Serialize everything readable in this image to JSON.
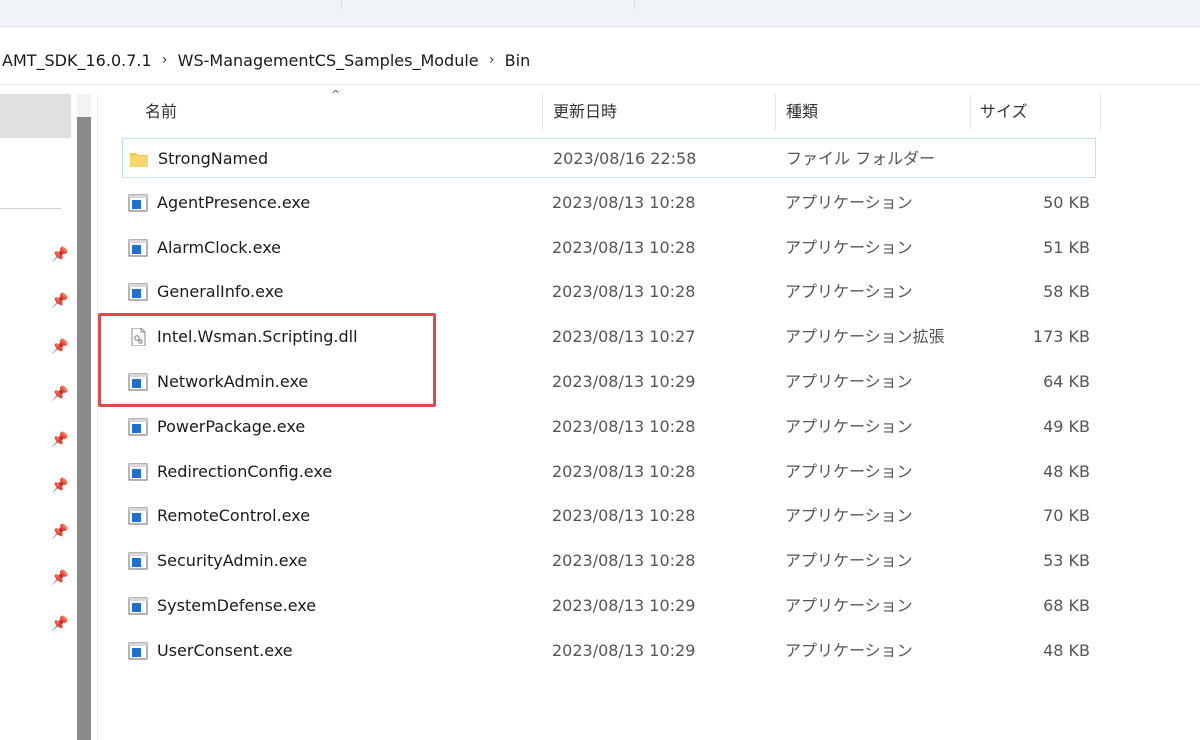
{
  "breadcrumb": {
    "items": [
      "AMT_SDK_16.0.7.1",
      "WS-ManagementCS_Samples_Module",
      "Bin"
    ]
  },
  "columns": {
    "name": "名前",
    "date": "更新日時",
    "type": "種類",
    "size": "サイズ"
  },
  "files": [
    {
      "name": "StrongNamed",
      "date": "2023/08/16 22:58",
      "type": "ファイル フォルダー",
      "size": "",
      "icon": "folder-icon"
    },
    {
      "name": "AgentPresence.exe",
      "date": "2023/08/13 10:28",
      "type": "アプリケーション",
      "size": "50 KB",
      "icon": "application-icon"
    },
    {
      "name": "AlarmClock.exe",
      "date": "2023/08/13 10:28",
      "type": "アプリケーション",
      "size": "51 KB",
      "icon": "application-icon"
    },
    {
      "name": "GeneralInfo.exe",
      "date": "2023/08/13 10:28",
      "type": "アプリケーション",
      "size": "58 KB",
      "icon": "application-icon"
    },
    {
      "name": "Intel.Wsman.Scripting.dll",
      "date": "2023/08/13 10:27",
      "type": "アプリケーション拡張",
      "size": "173 KB",
      "icon": "dll-file-icon"
    },
    {
      "name": "NetworkAdmin.exe",
      "date": "2023/08/13 10:29",
      "type": "アプリケーション",
      "size": "64 KB",
      "icon": "application-icon"
    },
    {
      "name": "PowerPackage.exe",
      "date": "2023/08/13 10:28",
      "type": "アプリケーション",
      "size": "49 KB",
      "icon": "application-icon"
    },
    {
      "name": "RedirectionConfig.exe",
      "date": "2023/08/13 10:28",
      "type": "アプリケーション",
      "size": "48 KB",
      "icon": "application-icon"
    },
    {
      "name": "RemoteControl.exe",
      "date": "2023/08/13 10:28",
      "type": "アプリケーション",
      "size": "70 KB",
      "icon": "application-icon"
    },
    {
      "name": "SecurityAdmin.exe",
      "date": "2023/08/13 10:28",
      "type": "アプリケーション",
      "size": "53 KB",
      "icon": "application-icon"
    },
    {
      "name": "SystemDefense.exe",
      "date": "2023/08/13 10:29",
      "type": "アプリケーション",
      "size": "68 KB",
      "icon": "application-icon"
    },
    {
      "name": "UserConsent.exe",
      "date": "2023/08/13 10:29",
      "type": "アプリケーション",
      "size": "48 KB",
      "icon": "application-icon"
    }
  ],
  "colors": {
    "highlight": "#e04a4f",
    "selection_border": "#bfe0f5",
    "folder": "#f2c94c",
    "app_blue": "#1f6fd0"
  }
}
